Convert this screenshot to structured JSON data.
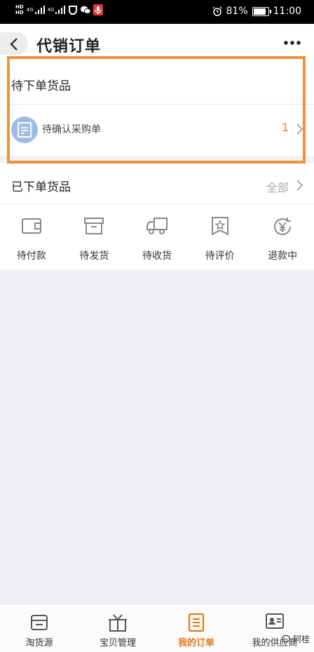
{
  "status_bar": {
    "hd_top": "HD",
    "hd_bottom": "HD",
    "net_1": "4G",
    "net_2": "4G",
    "battery_percent": "81%",
    "battery_level": 0.81,
    "time": "11:00"
  },
  "header": {
    "title": "代销订单"
  },
  "pending_section": {
    "title": "待下单货品",
    "item_label": "待确认采购单",
    "item_count": "1"
  },
  "ordered_section": {
    "title": "已下单货品",
    "all_link": "全部"
  },
  "order_statuses": [
    {
      "label": "待付款",
      "icon": "wallet-icon"
    },
    {
      "label": "待发货",
      "icon": "box-icon"
    },
    {
      "label": "待收货",
      "icon": "truck-icon"
    },
    {
      "label": "待评价",
      "icon": "bookmark-star-icon"
    },
    {
      "label": "退款中",
      "icon": "refund-yen-icon"
    }
  ],
  "tab_bar": {
    "tabs": [
      {
        "label": "淘货源",
        "icon": "store-icon"
      },
      {
        "label": "宝贝管理",
        "icon": "gift-icon"
      },
      {
        "label": "我的订单",
        "icon": "order-list-icon",
        "active": true
      },
      {
        "label": "我的供应商",
        "icon": "id-card-icon"
      }
    ]
  },
  "watermark": "阿桂",
  "colors": {
    "accent": "#e07a14",
    "highlight_border": "#f0903a",
    "doc_icon_bg": "#9dbde8"
  }
}
